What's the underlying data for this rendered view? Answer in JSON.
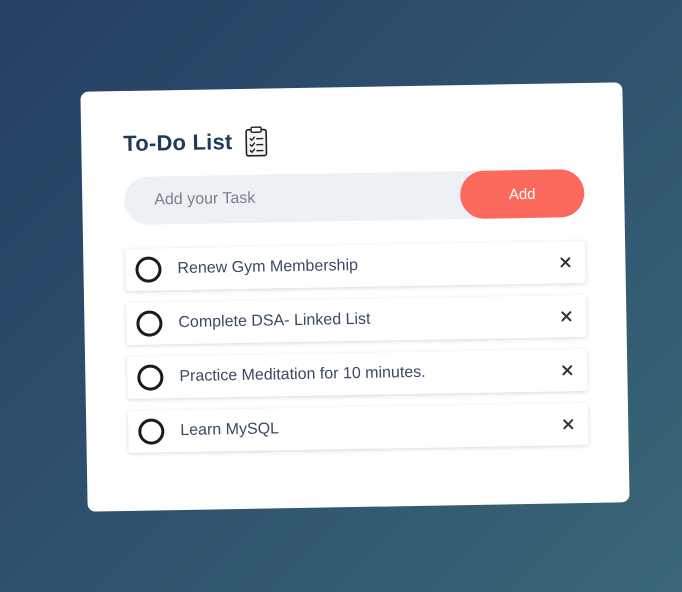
{
  "app": {
    "title": "To-Do List",
    "title_icon": "checklist-icon"
  },
  "input": {
    "placeholder": "Add your Task",
    "value": "",
    "add_label": "Add"
  },
  "tasks": [
    {
      "label": "Renew Gym Membership",
      "completed": false
    },
    {
      "label": "Complete DSA- Linked List",
      "completed": false
    },
    {
      "label": "Practice Meditation for 10 minutes.",
      "completed": false
    },
    {
      "label": "Learn MySQL",
      "completed": false
    }
  ],
  "icons": {
    "check": "circle-checkbox-icon",
    "delete": "close-icon"
  },
  "colors": {
    "accent": "#fb6a5c",
    "title": "#1f3a5c",
    "input_background": "#edf0f5"
  }
}
